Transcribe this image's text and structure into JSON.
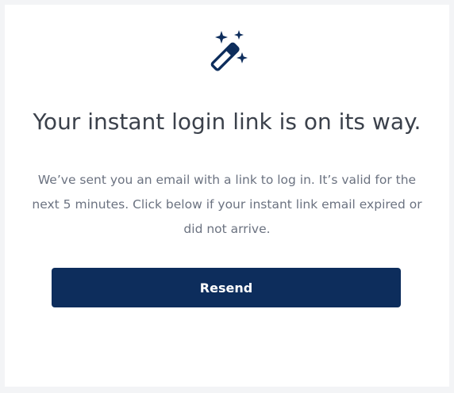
{
  "icons": {
    "header_icon": "magic-wand-sparkles-icon",
    "color": "#0d2d5c"
  },
  "title": "Your instant login link is on its way.",
  "message": "We’ve sent you an email with a link to log in. It’s valid for the next 5 minutes. Click below if your instant link email expired or did not arrive.",
  "resend_button": {
    "label": "Resend",
    "background": "#0d2d5c"
  }
}
